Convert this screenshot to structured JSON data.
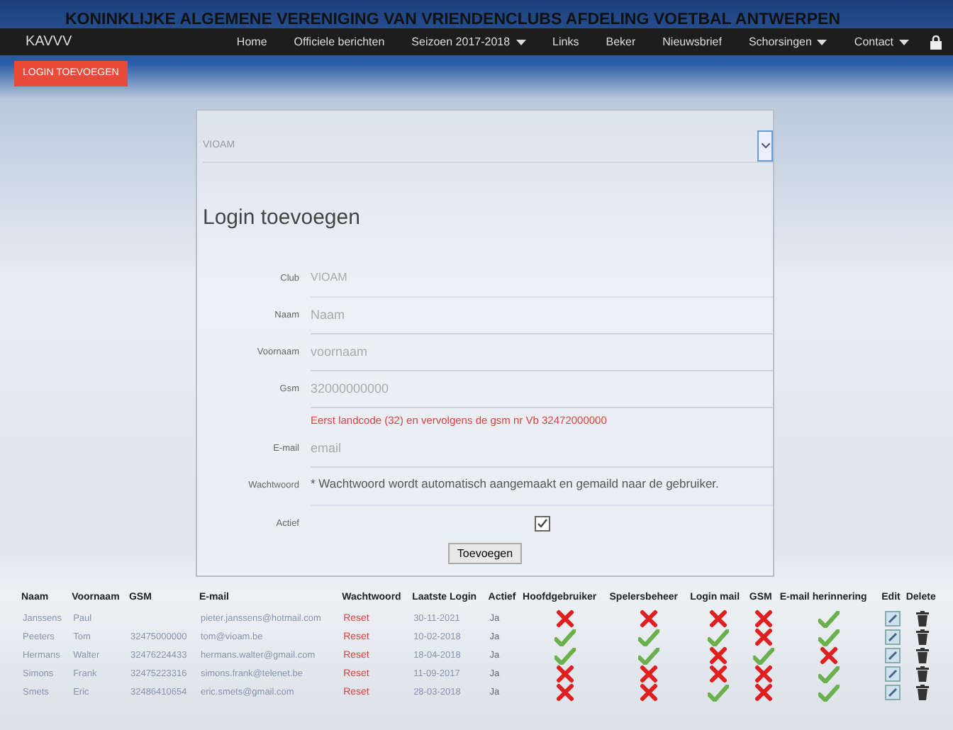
{
  "banner": {
    "title": "KONINKLIJKE ALGEMENE VERENIGING VAN VRIENDENCLUBS AFDELING VOETBAL ANTWERPEN"
  },
  "navbar": {
    "brand": "KAVVV",
    "items": [
      {
        "label": "Home",
        "dropdown": false
      },
      {
        "label": "Officiele berichten",
        "dropdown": false
      },
      {
        "label": "Seizoen 2017-2018",
        "dropdown": true
      },
      {
        "label": "Links",
        "dropdown": false
      },
      {
        "label": "Beker",
        "dropdown": false
      },
      {
        "label": "Nieuwsbrief",
        "dropdown": false
      },
      {
        "label": "Schorsingen",
        "dropdown": true
      },
      {
        "label": "Contact",
        "dropdown": true
      }
    ]
  },
  "add_login_button": "LOGIN TOEVOEGEN",
  "form": {
    "club_select": "VIOAM",
    "title": "Login toevoegen",
    "fields": [
      {
        "kind": "static",
        "label": "Club",
        "value": "VIOAM"
      },
      {
        "kind": "input",
        "label": "Naam",
        "placeholder": "Naam"
      },
      {
        "kind": "input",
        "label": "Voornaam",
        "placeholder": "voornaam"
      },
      {
        "kind": "input",
        "label": "Gsm",
        "placeholder": "32000000000",
        "hint": "Eerst landcode (32) en vervolgens de gsm nr Vb 32472000000"
      },
      {
        "kind": "input",
        "label": "E-mail",
        "placeholder": "email"
      },
      {
        "kind": "note",
        "label": "Wachtwoord",
        "value": "* Wachtwoord wordt automatisch aangemaakt en gemaild naar de gebruiker."
      },
      {
        "kind": "checkbox",
        "label": "Actief",
        "checked": true
      }
    ],
    "submit": "Toevoegen"
  },
  "table": {
    "columns": [
      "Naam",
      "Voornaam",
      "GSM",
      "E-mail",
      "Wachtwoord",
      "Laatste Login",
      "Actief",
      "Hoofdgebruiker",
      "Spelersbeheer",
      "Login mail",
      "GSM",
      "E-mail herinnering",
      "Edit",
      "Delete"
    ],
    "rows": [
      {
        "naam": "Janssens",
        "voornaam": "Paul",
        "gsm": "",
        "email": "pieter.janssens@hotmail.com",
        "wachtwoord": "Reset",
        "laatste_login": "30-11-2021",
        "actief": "Ja",
        "hoofdgebruiker": false,
        "spelersbeheer": false,
        "login_mail": false,
        "gsm_flag": false,
        "email_herinnering": true
      },
      {
        "naam": "Peeters",
        "voornaam": "Tom",
        "gsm": "32475000000",
        "email": "tom@vioam.be",
        "wachtwoord": "Reset",
        "laatste_login": "10-02-2018",
        "actief": "Ja",
        "hoofdgebruiker": true,
        "spelersbeheer": true,
        "login_mail": true,
        "gsm_flag": false,
        "email_herinnering": true
      },
      {
        "naam": "Hermans",
        "voornaam": "Walter",
        "gsm": "32476224433",
        "email": "hermans.walter@gmail.com",
        "wachtwoord": "Reset",
        "laatste_login": "18-04-2018",
        "actief": "Ja",
        "hoofdgebruiker": true,
        "spelersbeheer": true,
        "login_mail": false,
        "gsm_flag": true,
        "email_herinnering": false
      },
      {
        "naam": "Simons",
        "voornaam": "Frank",
        "gsm": "32475223316",
        "email": "simons.frank@telenet.be",
        "wachtwoord": "Reset",
        "laatste_login": "11-09-2017",
        "actief": "Ja",
        "hoofdgebruiker": false,
        "spelersbeheer": false,
        "login_mail": false,
        "gsm_flag": false,
        "email_herinnering": true
      },
      {
        "naam": "Smets",
        "voornaam": "Eric",
        "gsm": "32486410654",
        "email": "eric.smets@gmail.com",
        "wachtwoord": "Reset",
        "laatste_login": "28-03-2018",
        "actief": "Ja",
        "hoofdgebruiker": false,
        "spelersbeheer": false,
        "login_mail": true,
        "gsm_flag": false,
        "email_herinnering": true
      }
    ]
  }
}
